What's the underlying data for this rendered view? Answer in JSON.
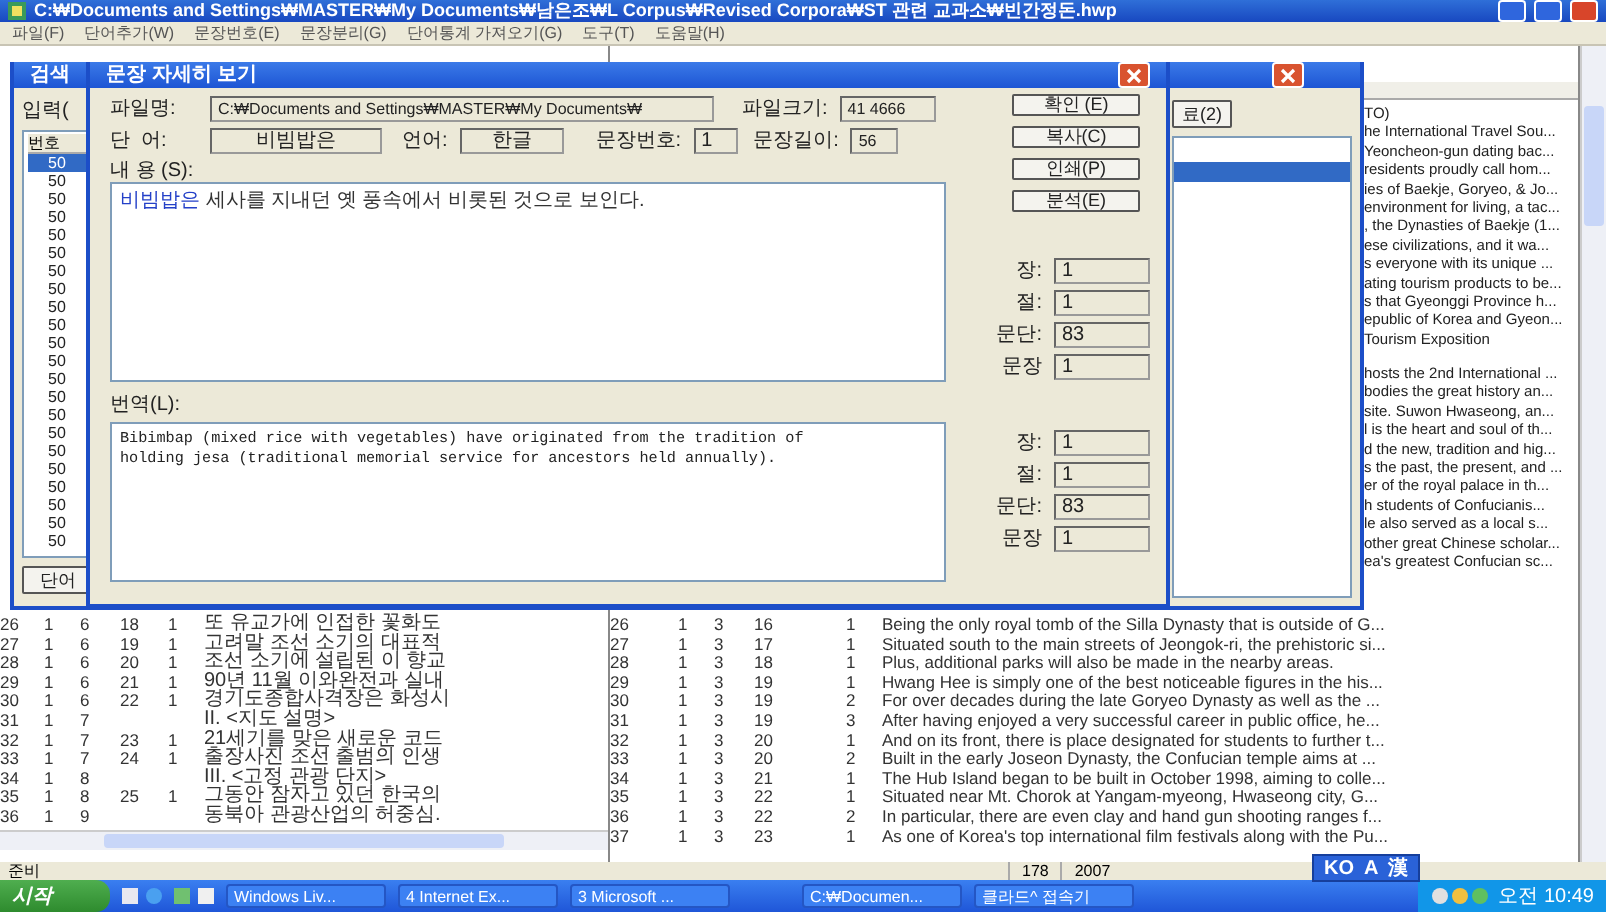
{
  "window": {
    "title": "C:₩Documents and Settings₩MASTER₩My Documents₩남은조₩L Corpus₩Revised Corpora₩ST 관련 교과소₩빈간정돈.hwp"
  },
  "menu": [
    "파일(F)",
    "단어추가(W)",
    "문장번호(E)",
    "문장분리(G)",
    "단어통계 가져오기(G)",
    "도구(T)",
    "도움말(H)"
  ],
  "right_fragments_top": [
    "TO)",
    "he International Travel Sou...",
    "Yeoncheon-gun dating bac...",
    "residents proudly call hom...",
    "ies of Baekje, Goryeo, & Jo...",
    "environment for living, a tac...",
    ", the Dynasties of Baekje (1...",
    "ese civilizations, and it wa...",
    "s everyone with its unique ...",
    "ating tourism products to be...",
    "s that Gyeonggi Province h...",
    "epublic of Korea and Gyeon...",
    "Tourism Exposition"
  ],
  "right_fragments_bottom": [
    "hosts the 2nd International ...",
    "bodies the great history an...",
    "site. Suwon Hwaseong, an...",
    "l is the heart and soul of th...",
    "d the new, tradition and hig...",
    "s the past, the present, and ...",
    "er of the royal palace in th...",
    "h students of Confucianis...",
    "le also served as a local s...",
    "other great Chinese scholar...",
    "ea's greatest Confucian sc..."
  ],
  "left_rows": [
    [
      "26",
      "1",
      "6",
      "18",
      "1",
      "또 유교가에 인접한 꽃화도"
    ],
    [
      "27",
      "1",
      "6",
      "19",
      "1",
      "고려말 조선 소기의 대표적"
    ],
    [
      "28",
      "1",
      "6",
      "20",
      "1",
      "조선 소기에 설립된 이 향교"
    ],
    [
      "29",
      "1",
      "6",
      "21",
      "1",
      "90년 11월 이와완전과 실내"
    ],
    [
      "30",
      "1",
      "6",
      "22",
      "1",
      "경기도종합사격장은 화성시"
    ],
    [
      "31",
      "1",
      "7",
      "",
      "",
      "II. <지도 설명>"
    ],
    [
      "32",
      "1",
      "7",
      "23",
      "1",
      "21세기를 맞은 새로운 코드"
    ],
    [
      "33",
      "1",
      "7",
      "24",
      "1",
      "출장사진 조선 출범의 인생"
    ],
    [
      "34",
      "1",
      "8",
      "",
      "",
      "III. <고정 관광 단지>"
    ],
    [
      "35",
      "1",
      "8",
      "25",
      "1",
      "그동안 잠자고 있던 한국의"
    ],
    [
      "36",
      "1",
      "9",
      "",
      "",
      "동북아 관광산업의 허중심."
    ]
  ],
  "right_rows": [
    [
      "26",
      "1",
      "3",
      "16",
      "1",
      "Being the only royal tomb of the Silla Dynasty that is outside of G..."
    ],
    [
      "27",
      "1",
      "3",
      "17",
      "1",
      "Situated south to the main streets of Jeongok-ri, the prehistoric si..."
    ],
    [
      "28",
      "1",
      "3",
      "18",
      "1",
      "Plus, additional parks will also be made in the nearby areas."
    ],
    [
      "29",
      "1",
      "3",
      "19",
      "1",
      "Hwang Hee is simply one of the best noticeable figures in the his..."
    ],
    [
      "30",
      "1",
      "3",
      "19",
      "2",
      "For over decades during the late Goryeo Dynasty as well as the ..."
    ],
    [
      "31",
      "1",
      "3",
      "19",
      "3",
      "After having enjoyed a very successful career in public office, he..."
    ],
    [
      "32",
      "1",
      "3",
      "20",
      "1",
      "And on its front, there is place designated for students to further t..."
    ],
    [
      "33",
      "1",
      "3",
      "20",
      "2",
      "Built in the early Joseon Dynasty, the Confucian temple aims at ..."
    ],
    [
      "34",
      "1",
      "3",
      "21",
      "1",
      "The Hub Island began to be built in October 1998, aiming to colle..."
    ],
    [
      "35",
      "1",
      "3",
      "22",
      "1",
      "Situated near Mt. Chorok at Yangam-myeong, Hwaseong city, G..."
    ],
    [
      "36",
      "1",
      "3",
      "22",
      "2",
      "In particular, there are even clay and hand gun shooting ranges f..."
    ],
    [
      "37",
      "1",
      "3",
      "23",
      "1",
      "As one of Korea's top international film festivals along with the Pu..."
    ]
  ],
  "status_bar": {
    "text": "준비",
    "count": "178",
    "year": "2007"
  },
  "ime_bar": {
    "mode": "KO",
    "letters": [
      "A",
      "漢"
    ]
  },
  "back_dialog": {
    "title": "검색",
    "input_label": "입력(",
    "list_header": "번호",
    "list_items": [
      {
        "label": "50",
        "selected": true
      },
      {
        "label": "50",
        "selected": false
      },
      {
        "label": "50",
        "selected": false
      },
      {
        "label": "50",
        "selected": false
      },
      {
        "label": "50",
        "selected": false
      },
      {
        "label": "50",
        "selected": false
      },
      {
        "label": "50",
        "selected": false
      },
      {
        "label": "50",
        "selected": false
      },
      {
        "label": "50",
        "selected": false
      },
      {
        "label": "50",
        "selected": false
      },
      {
        "label": "50",
        "selected": false
      },
      {
        "label": "50",
        "selected": false
      },
      {
        "label": "50",
        "selected": false
      },
      {
        "label": "50",
        "selected": false
      },
      {
        "label": "50",
        "selected": false
      },
      {
        "label": "50",
        "selected": false
      },
      {
        "label": "50",
        "selected": false
      },
      {
        "label": "50",
        "selected": false
      },
      {
        "label": "50",
        "selected": false
      },
      {
        "label": "50",
        "selected": false
      },
      {
        "label": "50",
        "selected": false
      },
      {
        "label": "50",
        "selected": false
      }
    ],
    "word_button": "단어",
    "close_button": "료(2)",
    "right_list": [
      {
        "selected": true
      }
    ]
  },
  "dialog": {
    "title": "문장 자세히 보기",
    "fields_row1": [
      {
        "label": "파일명:",
        "value": "C:₩Documents and Settings₩MASTER₩My Documents₩"
      },
      {
        "label": "파일크기:",
        "value": "41 4666"
      }
    ],
    "fields_row2": [
      {
        "label": "단  어:",
        "value": "비빔밥은"
      },
      {
        "label": "언어:",
        "value": "한글"
      },
      {
        "label": "문장번호:",
        "value": "1"
      },
      {
        "label": "문장길이:",
        "value": "56"
      }
    ],
    "buttons": [
      "확인 (E)",
      "복사(C)",
      "인쇄(P)",
      "분석(E)"
    ],
    "content_label": "내 용 (S):",
    "content": {
      "highlight": "비빔밥은",
      "text": " 세사를 지내던 옛 풍속에서 비롯된 것으로 보인다."
    },
    "content_position": [
      {
        "label": "장:",
        "value": "1"
      },
      {
        "label": "절:",
        "value": "1"
      },
      {
        "label": "문단:",
        "value": "83"
      },
      {
        "label": "문장",
        "value": "1"
      }
    ],
    "translation_label": "번역(L):",
    "translation": "Bibimbap (mixed rice with vegetables) have originated from the tradition of\nholding jesa (traditional memorial service for ancestors held annually).",
    "translation_position": [
      {
        "label": "장:",
        "value": "1"
      },
      {
        "label": "절:",
        "value": "1"
      },
      {
        "label": "문단:",
        "value": "83"
      },
      {
        "label": "문장",
        "value": "1"
      }
    ]
  },
  "taskbar": {
    "start": "시작",
    "tasks": [
      "Windows Liv...",
      "4 Internet Ex...",
      "3 Microsoft ...",
      "C:₩Documen...",
      "클라드^ 접속기"
    ],
    "clock": "오전 10:49"
  }
}
